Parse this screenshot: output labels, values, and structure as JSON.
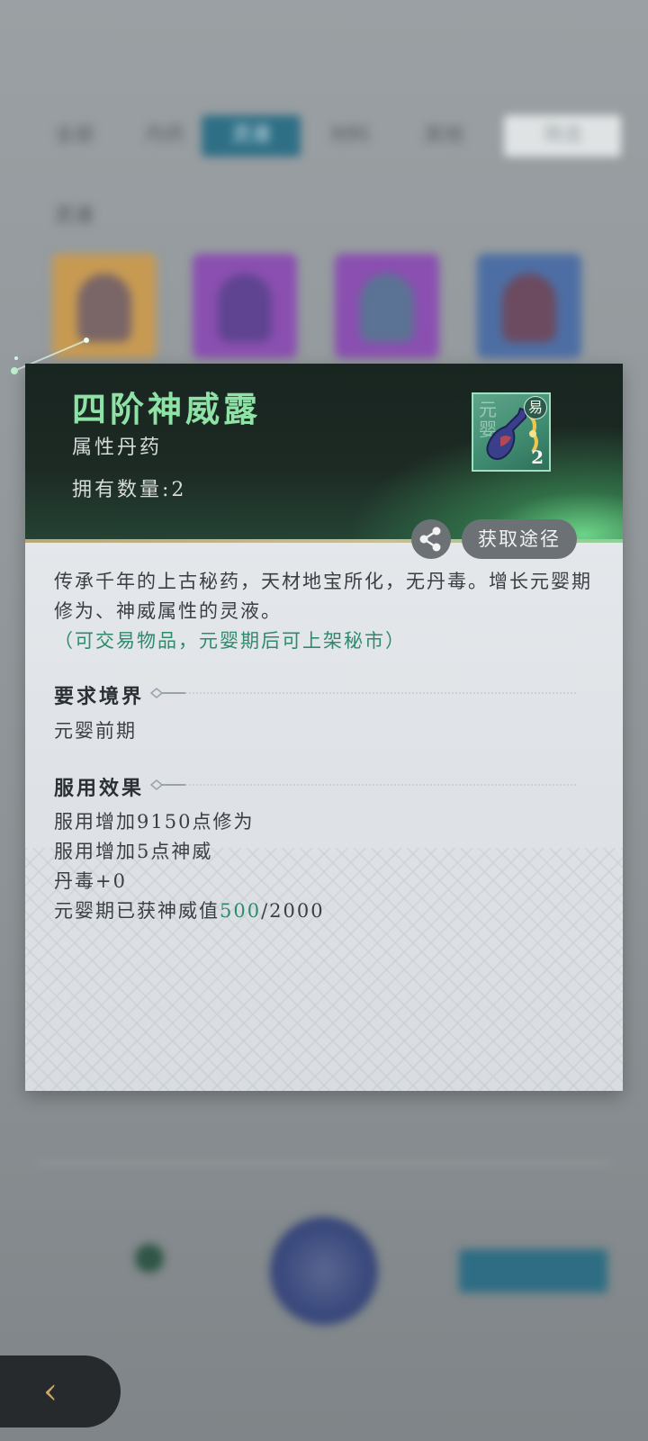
{
  "background": {
    "tabs": [
      "全部",
      "丹药",
      "灵液",
      "材料",
      "其他",
      "筛选"
    ],
    "active_tab_index": 2,
    "section_title": "灵液"
  },
  "dialog": {
    "title": "四阶神威露",
    "subtitle": "属性丹药",
    "owned_label": "拥有数量:",
    "owned_value": "2",
    "item_icon": {
      "icon": "elixir-bottle-icon",
      "realm_text": "元婴",
      "trade_badge": "易",
      "quantity": "2"
    },
    "share_icon": "share-icon",
    "source_button": "获取途径",
    "description": "传承千年的上古秘药，天材地宝所化，无丹毒。增长元婴期修为、神威属性的灵液。",
    "trade_note": "（可交易物品，元婴期后可上架秘市）",
    "requirement": {
      "title": "要求境界",
      "value": "元婴前期"
    },
    "effects": {
      "title": "服用效果",
      "lines": [
        "服用增加9150点修为",
        "服用增加5点神威",
        "丹毒+0"
      ],
      "progress_label": "元婴期已获神威值",
      "progress_current": "500",
      "progress_total": "/2000"
    }
  },
  "colors": {
    "title_green": "#8fe2a6",
    "note_green": "#2f8a6c",
    "header_dark": "#1d2a24",
    "button_gray": "#6c7175"
  }
}
